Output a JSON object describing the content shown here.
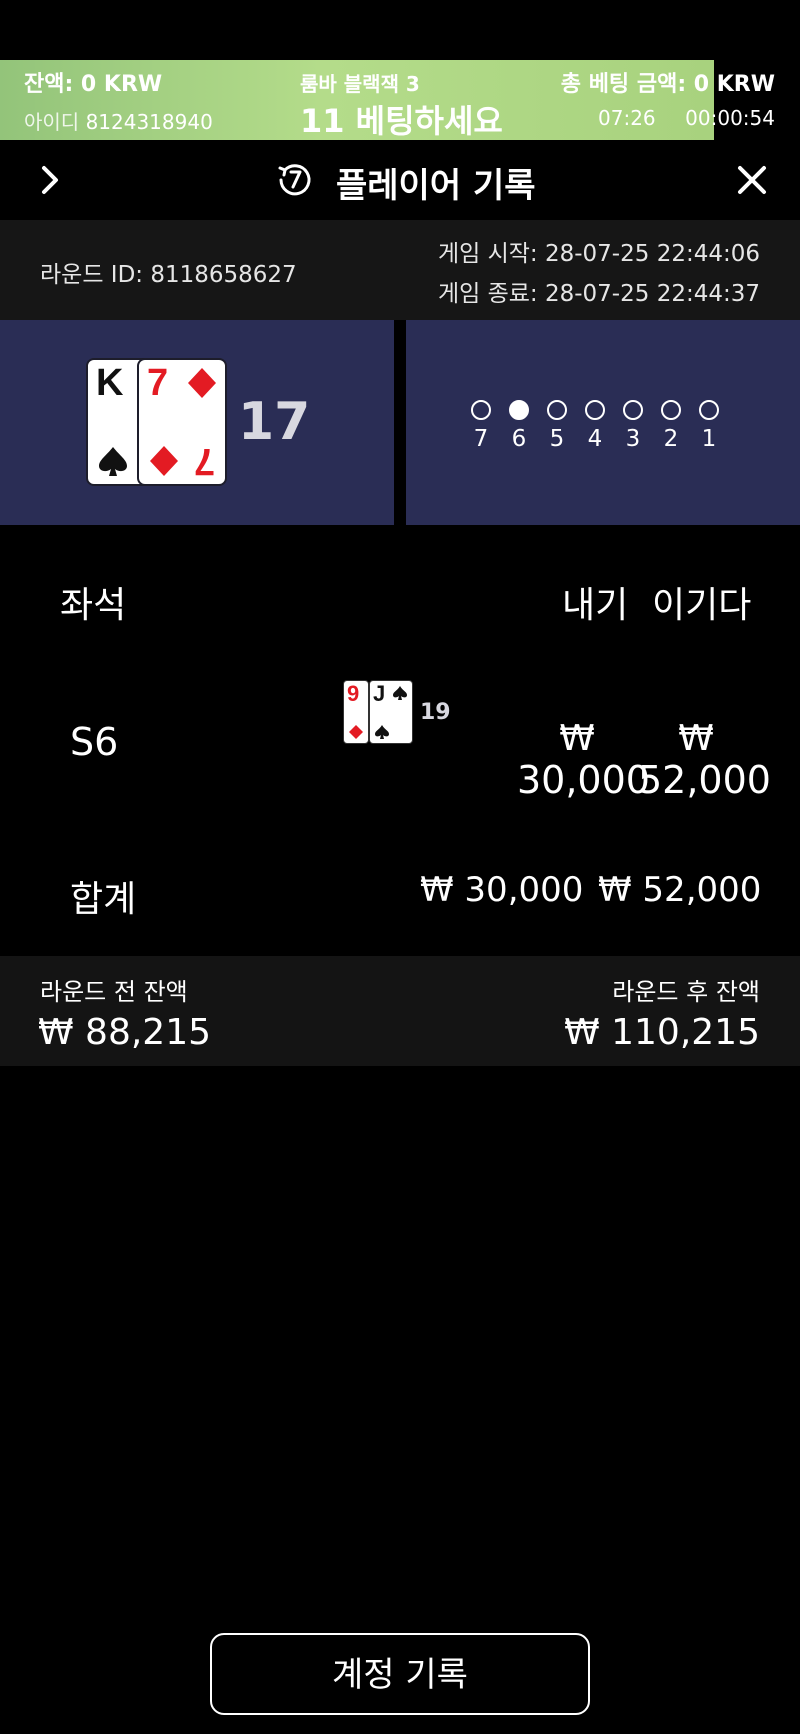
{
  "topbar": {
    "balance": "잔액: 0 KRW",
    "table_name": "룸바 블랙잭 3",
    "total_bet": "총 베팅 금액: 0 KRW",
    "id_label": "아이디",
    "id_value": "8124318940",
    "status": "11 베팅하세요",
    "clock": "07:26",
    "timer": "00:00:54",
    "colors": {
      "bar": "#b4dc8a"
    }
  },
  "header": {
    "title": "플레이어 기록",
    "back_icon": "chevron-right-icon",
    "history_icon": "history-icon",
    "close_icon": "close-icon"
  },
  "round": {
    "id": "라운드 ID: 8118658627",
    "start": "게임 시작: 28-07-25 22:44:06",
    "end": "게임 종료: 28-07-25 22:44:37"
  },
  "dealer_hand": {
    "cards": [
      {
        "rank": "K",
        "suit": "spade",
        "color": "#111111"
      },
      {
        "rank": "7",
        "suit": "diamond",
        "color": "#e31b23"
      }
    ],
    "total": "17"
  },
  "seats": {
    "numbers": [
      "7",
      "6",
      "5",
      "4",
      "3",
      "2",
      "1"
    ],
    "active": "6"
  },
  "table": {
    "headers": {
      "seat": "좌석",
      "bet": "내기",
      "win": "이기다"
    },
    "rows": [
      {
        "seat": "S6",
        "cards": [
          {
            "rank": "9",
            "suit": "diamond",
            "color": "#e31b23"
          },
          {
            "rank": "J",
            "suit": "spade",
            "color": "#111111"
          }
        ],
        "hand_total": "19",
        "bet_currency": "₩",
        "bet": "30,000",
        "win_currency": "₩",
        "win": "52,000"
      }
    ],
    "sum_label": "합계",
    "sum_bet": "₩ 30,000",
    "sum_win": "₩ 52,000"
  },
  "balances": {
    "before_label": "라운드 전 잔액",
    "before_value": "₩ 88,215",
    "after_label": "라운드 후 잔액",
    "after_value": "₩ 110,215"
  },
  "account_button": "계정 기록"
}
